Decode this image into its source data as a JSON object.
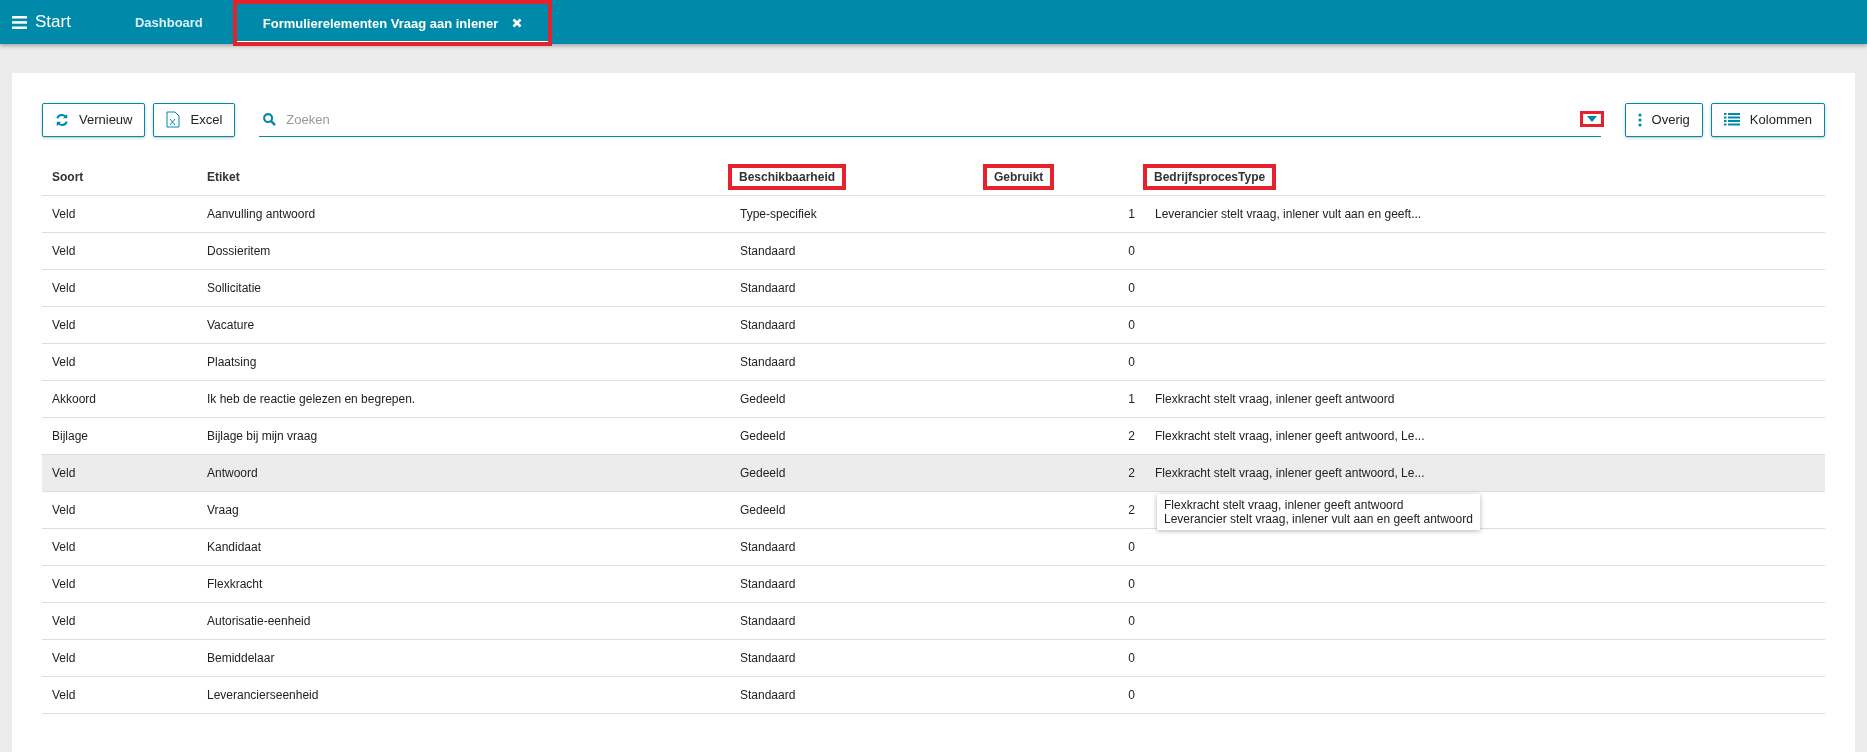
{
  "topbar": {
    "menu_label": "Start",
    "tabs": [
      {
        "label": "Dashboard",
        "selected": false,
        "closable": false,
        "highlighted": false
      },
      {
        "label": "Formulierelementen Vraag aan inlener",
        "selected": true,
        "closable": true,
        "highlighted": true
      }
    ]
  },
  "toolbar": {
    "left_buttons": [
      {
        "label": "Vernieuw",
        "kind": "refresh"
      },
      {
        "label": "Excel",
        "kind": "excel"
      }
    ],
    "search": {
      "placeholder": "Zoeken",
      "dropdown_highlighted": true
    },
    "right_buttons": [
      {
        "label": "Overig",
        "kind": "more"
      },
      {
        "label": "Kolommen",
        "kind": "columns"
      }
    ]
  },
  "table": {
    "columns": [
      {
        "label": "Soort",
        "kind": "text",
        "highlighted": false
      },
      {
        "label": "Etiket",
        "kind": "text",
        "highlighted": false
      },
      {
        "label": "Beschikbaarheid",
        "kind": "text",
        "highlighted": true
      },
      {
        "label": "Gebruikt",
        "kind": "number",
        "highlighted": true
      },
      {
        "label": "BedrijfsprocesType",
        "kind": "text",
        "highlighted": true
      }
    ],
    "rows": [
      {
        "cells": [
          "Veld",
          "Aanvulling antwoord",
          "Type-specifiek",
          "1",
          "Leverancier stelt vraag, inlener vult aan en geeft..."
        ],
        "hovered": false
      },
      {
        "cells": [
          "Veld",
          "Dossieritem",
          "Standaard",
          "0",
          ""
        ],
        "hovered": false
      },
      {
        "cells": [
          "Veld",
          "Sollicitatie",
          "Standaard",
          "0",
          ""
        ],
        "hovered": false
      },
      {
        "cells": [
          "Veld",
          "Vacature",
          "Standaard",
          "0",
          ""
        ],
        "hovered": false
      },
      {
        "cells": [
          "Veld",
          "Plaatsing",
          "Standaard",
          "0",
          ""
        ],
        "hovered": false
      },
      {
        "cells": [
          "Akkoord",
          "Ik heb de reactie gelezen en begrepen.",
          "Gedeeld",
          "1",
          "Flexkracht stelt vraag, inlener geeft antwoord"
        ],
        "hovered": false
      },
      {
        "cells": [
          "Bijlage",
          "Bijlage bij mijn vraag",
          "Gedeeld",
          "2",
          "Flexkracht stelt vraag, inlener geeft antwoord, Le..."
        ],
        "hovered": false
      },
      {
        "cells": [
          "Veld",
          "Antwoord",
          "Gedeeld",
          "2",
          "Flexkracht stelt vraag, inlener geeft antwoord, Le..."
        ],
        "hovered": true,
        "tooltip": [
          "Flexkracht stelt vraag, inlener geeft antwoord",
          "Leverancier stelt vraag, inlener vult aan en geeft antwoord"
        ]
      },
      {
        "cells": [
          "Veld",
          "Vraag",
          "Gedeeld",
          "2",
          ""
        ],
        "hovered": false
      },
      {
        "cells": [
          "Veld",
          "Kandidaat",
          "Standaard",
          "0",
          ""
        ],
        "hovered": false
      },
      {
        "cells": [
          "Veld",
          "Flexkracht",
          "Standaard",
          "0",
          ""
        ],
        "hovered": false
      },
      {
        "cells": [
          "Veld",
          "Autorisatie-eenheid",
          "Standaard",
          "0",
          ""
        ],
        "hovered": false
      },
      {
        "cells": [
          "Veld",
          "Bemiddelaar",
          "Standaard",
          "0",
          ""
        ],
        "hovered": false
      },
      {
        "cells": [
          "Veld",
          "Leverancierseenheid",
          "Standaard",
          "0",
          ""
        ],
        "hovered": false
      }
    ]
  }
}
